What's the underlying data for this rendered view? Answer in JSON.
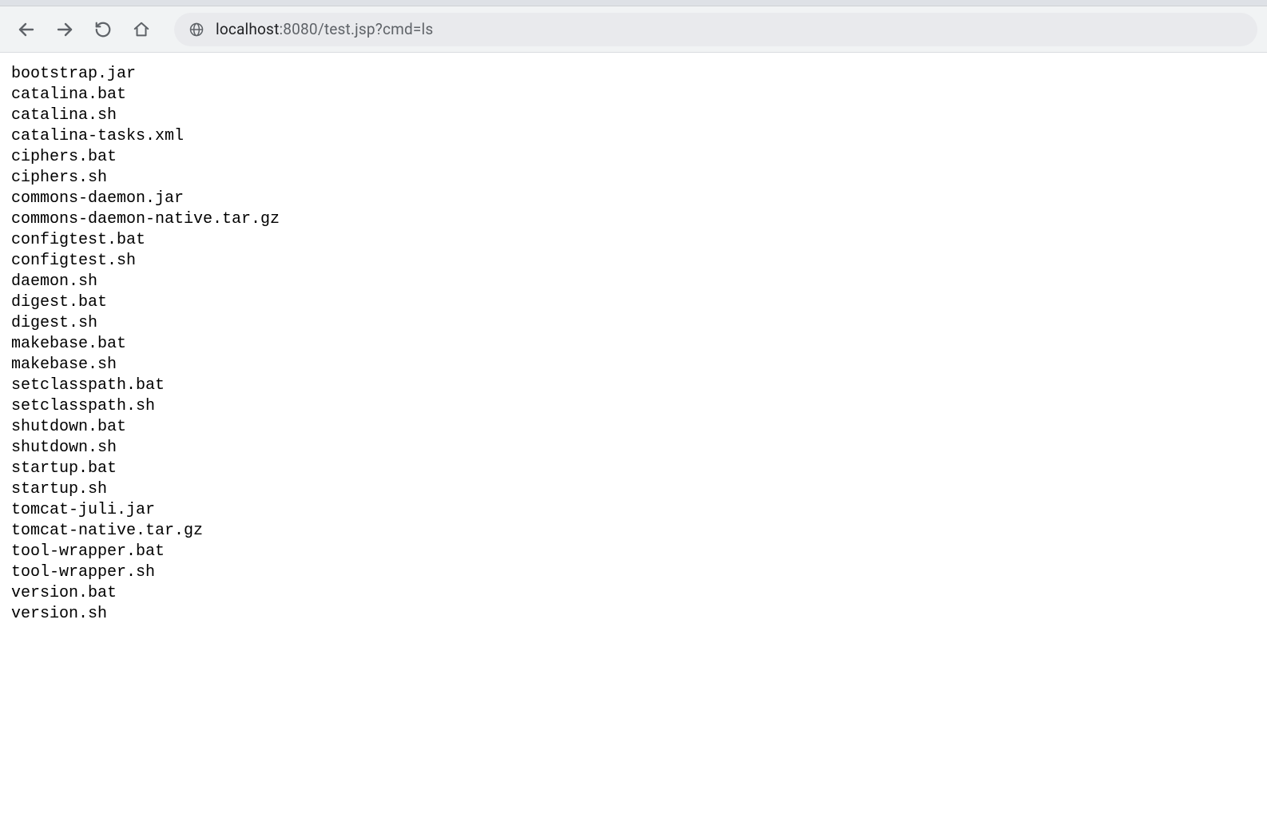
{
  "toolbar": {
    "url_host": "localhost",
    "url_port": ":8080",
    "url_path": "/test.jsp?cmd=ls"
  },
  "output": {
    "lines": [
      "bootstrap.jar",
      "catalina.bat",
      "catalina.sh",
      "catalina-tasks.xml",
      "ciphers.bat",
      "ciphers.sh",
      "commons-daemon.jar",
      "commons-daemon-native.tar.gz",
      "configtest.bat",
      "configtest.sh",
      "daemon.sh",
      "digest.bat",
      "digest.sh",
      "makebase.bat",
      "makebase.sh",
      "setclasspath.bat",
      "setclasspath.sh",
      "shutdown.bat",
      "shutdown.sh",
      "startup.bat",
      "startup.sh",
      "tomcat-juli.jar",
      "tomcat-native.tar.gz",
      "tool-wrapper.bat",
      "tool-wrapper.sh",
      "version.bat",
      "version.sh"
    ]
  }
}
